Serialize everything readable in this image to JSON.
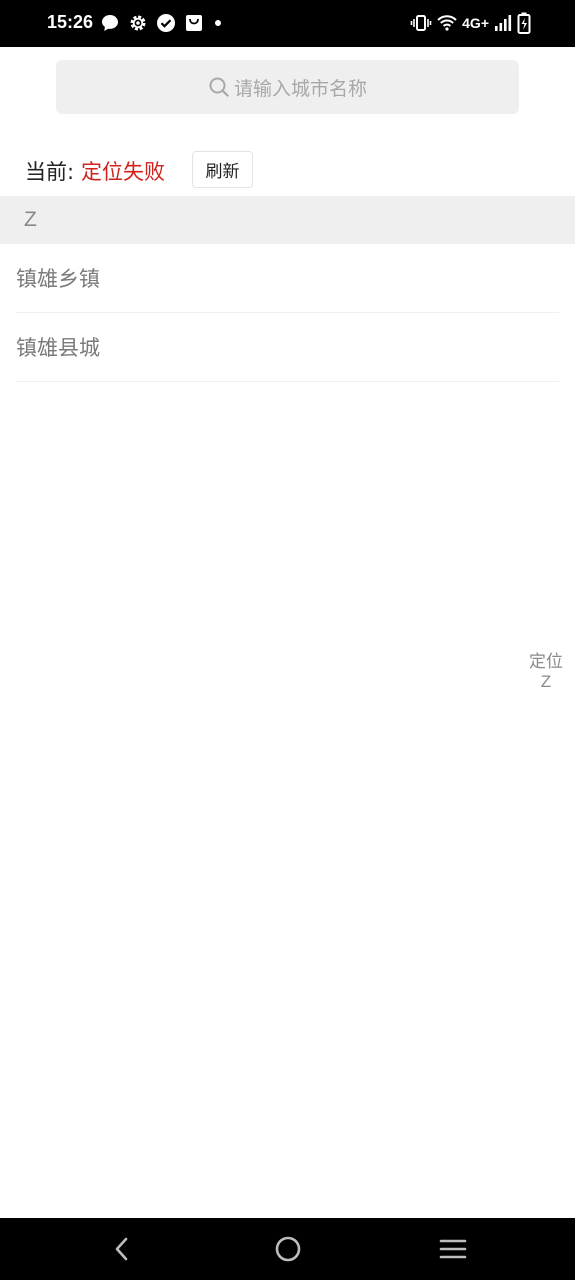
{
  "status_bar": {
    "time": "15:26",
    "left_icons": [
      "chat-bubble-icon",
      "gear-icon",
      "check-circle-icon",
      "shopping-bag-icon",
      "dot-icon"
    ],
    "network_type": "4G+",
    "right_icons": [
      "vibrate-icon",
      "wifi-icon",
      "signal-icon",
      "battery-charging-icon"
    ]
  },
  "search": {
    "placeholder": "请输入城市名称",
    "icon": "search-icon"
  },
  "current": {
    "label": "当前:",
    "value": "定位失败",
    "value_color": "#d0231e",
    "refresh_label": "刷新"
  },
  "sections": [
    {
      "letter": "Z",
      "cities": [
        "镇雄乡镇",
        "镇雄县城"
      ]
    }
  ],
  "side_index": {
    "items": [
      "定位",
      "Z"
    ]
  },
  "nav_bar": {
    "buttons": [
      "back-icon",
      "home-icon",
      "menu-icon"
    ]
  }
}
